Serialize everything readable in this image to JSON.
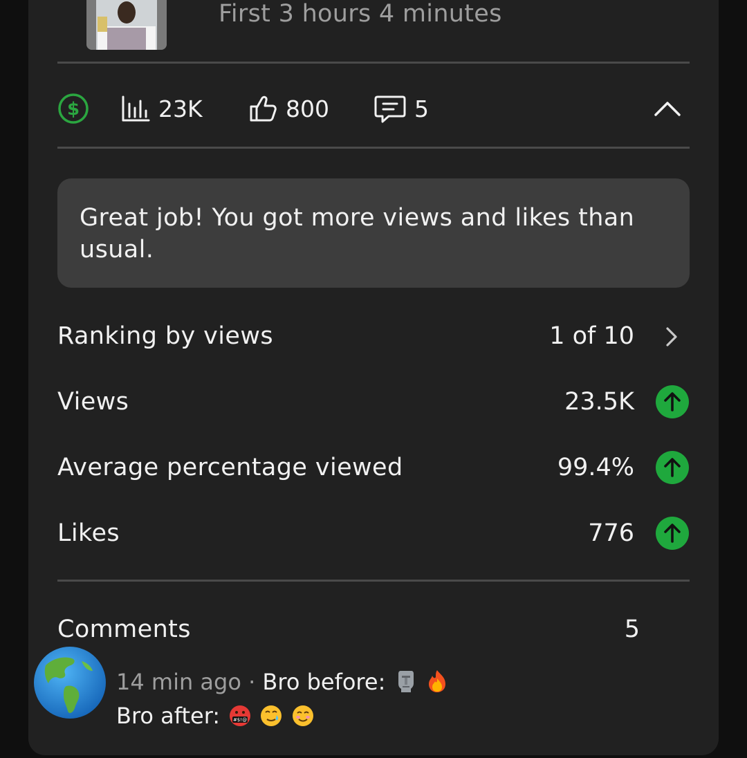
{
  "video": {
    "subtitle": "First 3 hours 4 minutes"
  },
  "stats_bar": {
    "monetization_icon": "dollar-circle-icon",
    "views": "23K",
    "likes": "800",
    "comments": "5",
    "collapse_icon": "chevron-up-icon"
  },
  "callout": {
    "text": "Great job! You got more views and likes than usual."
  },
  "metrics": [
    {
      "label": "Ranking by views",
      "value": "1 of 10",
      "icon": "chevron-right-icon"
    },
    {
      "label": "Views",
      "value": "23.5K",
      "icon": "arrow-up-circle-icon"
    },
    {
      "label": "Average percentage viewed",
      "value": "99.4%",
      "icon": "arrow-up-circle-icon"
    },
    {
      "label": "Likes",
      "value": "776",
      "icon": "arrow-up-circle-icon"
    }
  ],
  "comments_section": {
    "label": "Comments",
    "count": "5"
  },
  "top_comment": {
    "time": "14 min ago",
    "separator": "·",
    "line1": "Bro before:",
    "line2": "Bro after:",
    "avatar_icon": "globe-americas-icon"
  },
  "colors": {
    "card_background": "#212121",
    "callout_background": "#3d3d3d",
    "positive": "#1fa83d",
    "monetization": "#2ba640",
    "secondary_text": "#9e9e9e"
  }
}
